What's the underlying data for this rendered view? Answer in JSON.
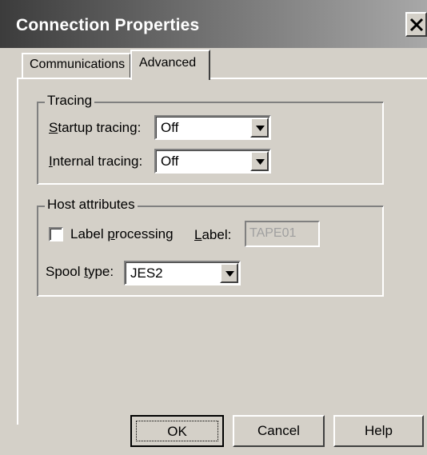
{
  "window": {
    "title": "Connection Properties"
  },
  "tabs": [
    {
      "label": "Communications",
      "selected": false
    },
    {
      "label": "Advanced",
      "selected": true
    }
  ],
  "tracing": {
    "legend": "Tracing",
    "startup": {
      "label_prefix": "",
      "label_underline": "S",
      "label_rest": "tartup tracing:",
      "value": "Off"
    },
    "internal": {
      "label_underline": "I",
      "label_rest": "nternal tracing:",
      "value": "Off"
    }
  },
  "host": {
    "legend": "Host attributes",
    "label_processing": {
      "prefix": "Label ",
      "underline": "p",
      "rest": "rocessing",
      "checked": false
    },
    "label_field": {
      "underline": "L",
      "rest": "abel:",
      "value": "TAPE01"
    },
    "spool": {
      "prefix": "Spool ",
      "underline": "t",
      "rest": "ype:",
      "value": "JES2"
    }
  },
  "buttons": {
    "ok": "OK",
    "cancel": "Cancel",
    "help": "Help"
  },
  "colors": {
    "dialog_face": "#d4d0c8",
    "title_dark": "#3c3c3c",
    "title_light": "#a8a8a8"
  }
}
